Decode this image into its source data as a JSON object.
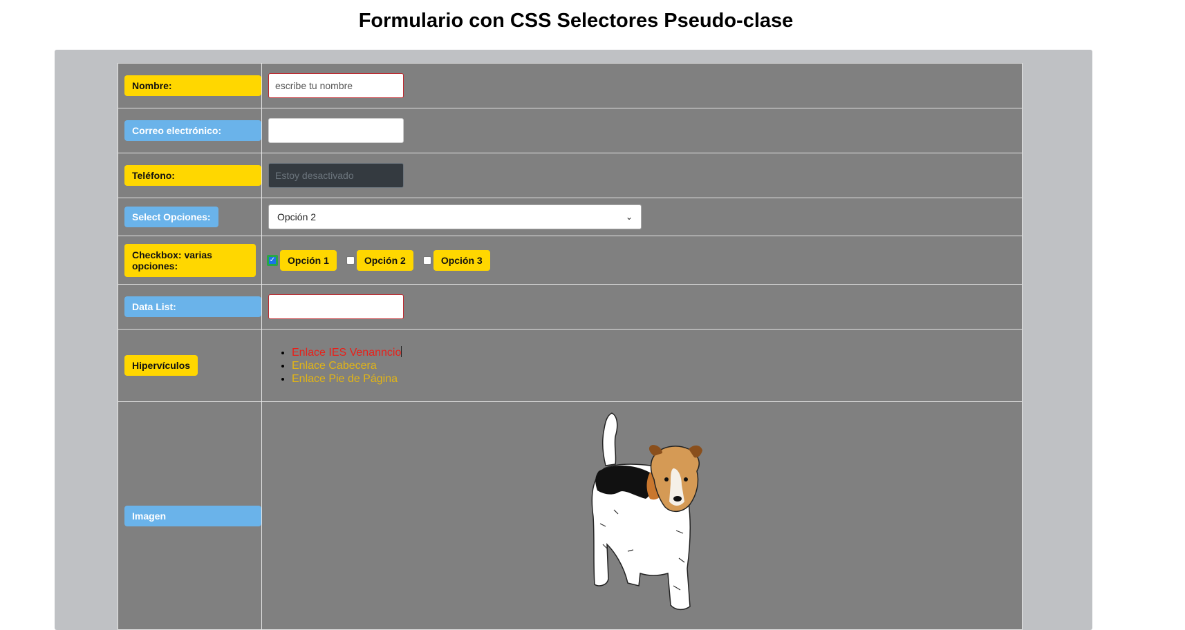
{
  "page": {
    "title": "Formulario con CSS Selectores Pseudo-clase"
  },
  "form": {
    "nombre": {
      "label": "Nombre:",
      "placeholder": "escribe tu nombre"
    },
    "correo": {
      "label": "Correo electrónico:",
      "value": ""
    },
    "telefono": {
      "label": "Teléfono:",
      "placeholder": "Estoy desactivado"
    },
    "select": {
      "label": "Select Opciones:",
      "selected": "Opción 2"
    },
    "checkbox": {
      "label": "Checkbox: varias opciones:",
      "options": [
        {
          "label": "Opción 1",
          "checked": true
        },
        {
          "label": "Opción 2",
          "checked": false
        },
        {
          "label": "Opción 3",
          "checked": false
        }
      ]
    },
    "datalist": {
      "label": "Data List:",
      "value": ""
    },
    "hipervinculos": {
      "label": "Hipervículos",
      "links": [
        "Enlace IES Venanncio",
        "Enlace Cabecera",
        "Enlace Pie de Página"
      ]
    },
    "imagen": {
      "label": "Imagen"
    }
  },
  "colors": {
    "label_yellow": "#ffd700",
    "label_blue": "#6ab3ea",
    "link_active": "#e8201a",
    "link_visited": "#e3b514",
    "table_bg": "#808080"
  }
}
